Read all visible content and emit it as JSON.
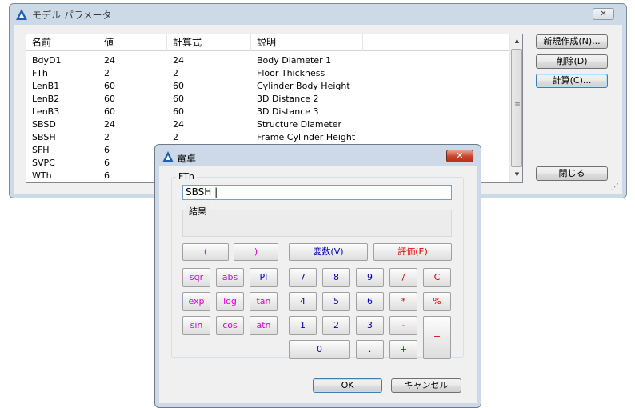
{
  "main_window": {
    "title": "モデル パラメータ",
    "close_glyph": "✕",
    "columns": [
      "名前",
      "値",
      "計算式",
      "説明"
    ],
    "rows": [
      [
        "BdyD1",
        "24",
        "24",
        "Body Diameter 1"
      ],
      [
        "FTh",
        "2",
        "2",
        "Floor Thickness"
      ],
      [
        "LenB1",
        "60",
        "60",
        "Cylinder Body Height"
      ],
      [
        "LenB2",
        "60",
        "60",
        "3D Distance 2"
      ],
      [
        "LenB3",
        "60",
        "60",
        "3D Distance 3"
      ],
      [
        "SBSD",
        "24",
        "24",
        "Structure Diameter"
      ],
      [
        "SBSH",
        "2",
        "2",
        "Frame Cylinder Height"
      ],
      [
        "SFH",
        "6",
        "",
        ""
      ],
      [
        "SVPC",
        "6",
        "",
        ""
      ],
      [
        "WTh",
        "6",
        "",
        ""
      ]
    ],
    "buttons": {
      "new": "新規作成(N)...",
      "delete": "削除(D)",
      "calc": "計算(C)...",
      "close": "閉じる"
    },
    "scroll_up": "▲",
    "scroll_down": "▼",
    "grip": "≡",
    "resize_grip": "⋰"
  },
  "calculator": {
    "title": "電卓",
    "close_glyph": "✕",
    "group_label": "FTh",
    "input_value": "SBSH |",
    "result_label": "結果",
    "keys": {
      "lparen": "(",
      "rparen": ")",
      "variable": "変数(V)",
      "evaluate": "評価(E)",
      "sqr": "sqr",
      "abs": "abs",
      "pi": "PI",
      "exp": "exp",
      "log": "log",
      "tan": "tan",
      "sin": "sin",
      "cos": "cos",
      "atn": "atn",
      "n7": "7",
      "n8": "8",
      "n9": "9",
      "div": "/",
      "clear": "C",
      "n4": "4",
      "n5": "5",
      "n6": "6",
      "mul": "*",
      "pct": "%",
      "n1": "1",
      "n2": "2",
      "n3": "3",
      "minus": "-",
      "equals": "=",
      "n0": "0",
      "dot": ".",
      "plus": "+"
    },
    "ok": "OK",
    "cancel": "キャンセル"
  },
  "icons": {
    "app": "autocad-a-icon"
  },
  "colors": {
    "frame": "#ccdae8",
    "accent_blue": "#1e5fb4",
    "key_pink": "#e000d8",
    "key_blue": "#0000c0",
    "key_red": "#e00000",
    "close_red": "#c7432a"
  }
}
